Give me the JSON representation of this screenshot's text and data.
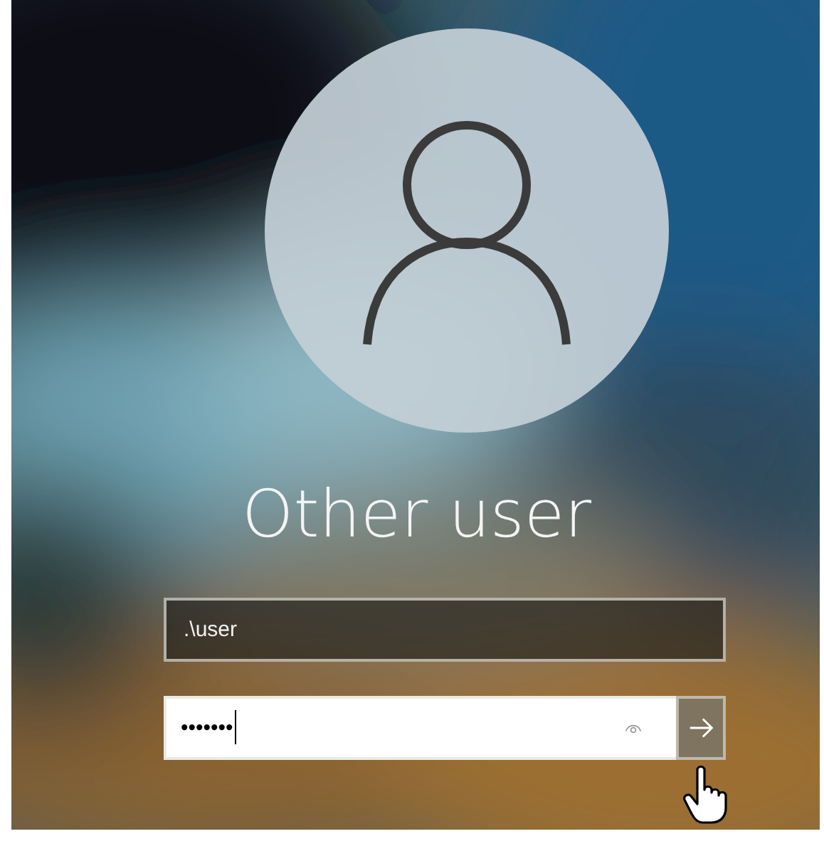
{
  "user_name": "Other user",
  "username_field": {
    "value": ".\\user"
  },
  "password_field": {
    "value": "•••••••"
  }
}
